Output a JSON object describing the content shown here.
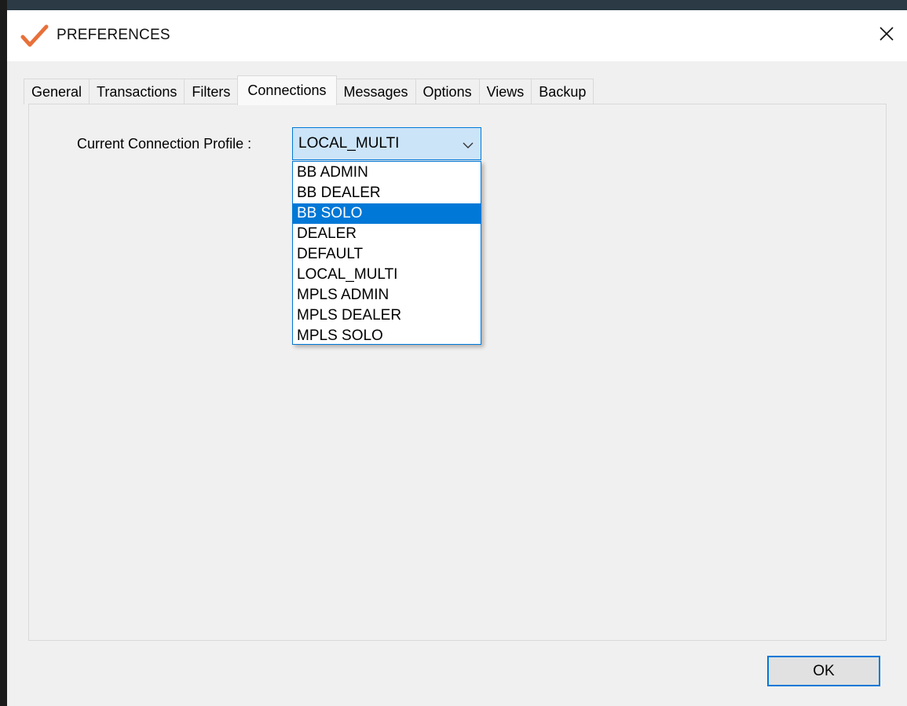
{
  "window": {
    "title": "PREFERENCES",
    "app_icon": "checkmark-icon",
    "close_icon": "close-icon",
    "colors": {
      "accent": "#0078d7",
      "selection_bg": "#0078d7",
      "combo_bg": "#cce4f7",
      "client_bg": "#f0f0f0",
      "icon_color": "#e8703a"
    }
  },
  "tabs": [
    {
      "label": "General",
      "active": false
    },
    {
      "label": "Transactions",
      "active": false
    },
    {
      "label": "Filters",
      "active": false
    },
    {
      "label": "Connections",
      "active": true
    },
    {
      "label": "Messages",
      "active": false
    },
    {
      "label": "Options",
      "active": false
    },
    {
      "label": "Views",
      "active": false
    },
    {
      "label": "Backup",
      "active": false
    }
  ],
  "connections": {
    "profile_label": "Current Connection Profile :",
    "current_value": "LOCAL_MULTI",
    "dropdown_icon": "chevron-down-icon",
    "highlighted_option": "BB SOLO",
    "options": [
      "BB ADMIN",
      "BB DEALER",
      "BB SOLO",
      "DEALER",
      "DEFAULT",
      "LOCAL_MULTI",
      "MPLS ADMIN",
      "MPLS DEALER",
      "MPLS SOLO"
    ]
  },
  "footer": {
    "ok_label": "OK"
  }
}
